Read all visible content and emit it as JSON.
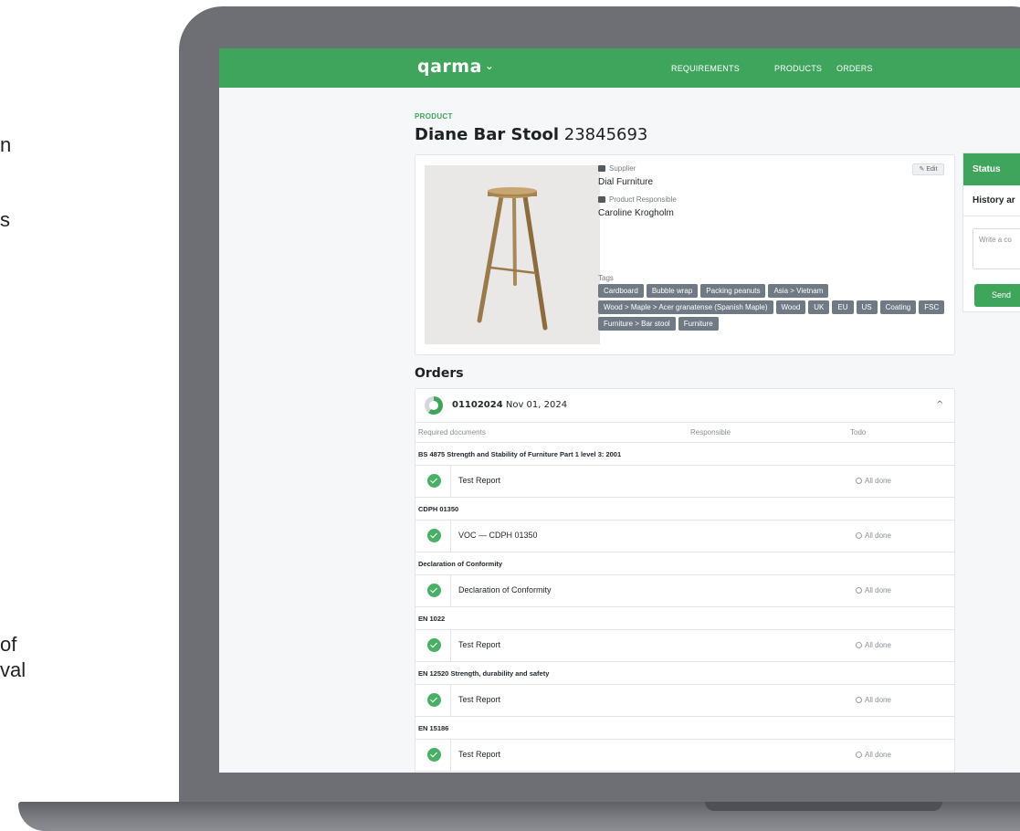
{
  "side_text": [
    "n",
    "s",
    "of",
    "val"
  ],
  "nav": {
    "logo": "qarma",
    "logo_caret": "⌄",
    "links": [
      "REQUIREMENTS",
      "PRODUCTS",
      "ORDERS"
    ]
  },
  "product": {
    "eyebrow": "PRODUCT",
    "name": "Diane Bar Stool",
    "number": "23845693",
    "supplier_label": "Supplier",
    "supplier": "Dial Furniture",
    "responsible_label": "Product Responsible",
    "responsible": "Caroline Krogholm",
    "edit_label": "Edit",
    "tags_label": "Tags",
    "tags": [
      "Cardboard",
      "Bubble wrap",
      "Packing peanuts",
      "Asia > Vietnam",
      "Wood > Maple > Acer granatense (Spanish Maple)",
      "Wood",
      "UK",
      "EU",
      "US",
      "Coating",
      "FSC",
      "Furniture > Bar stool",
      "Furniture"
    ]
  },
  "status_panel": {
    "title": "Status",
    "history": "History ar",
    "comment_placeholder": "Write a co",
    "send_label": "Send"
  },
  "orders": {
    "title": "Orders",
    "order_id": "01102024",
    "order_date": "Nov 01, 2024",
    "progress": 0.6,
    "columns": [
      "Required documents",
      "Responsible",
      "Todo"
    ],
    "groups": [
      {
        "name": "BS 4875 Strength and Stability of Furniture Part 1 level 3: 2001",
        "doc": "Test Report",
        "todo": "All done"
      },
      {
        "name": "CDPH 01350",
        "doc": "VOC — CDPH 01350",
        "todo": "All done"
      },
      {
        "name": "Declaration of Conformity",
        "doc": "Declaration of Conformity",
        "todo": "All done"
      },
      {
        "name": "EN 1022",
        "doc": "Test Report",
        "todo": "All done"
      },
      {
        "name": "EN 12520 Strength, durability and safety",
        "doc": "Test Report",
        "todo": "All done"
      },
      {
        "name": "EN 15186",
        "doc": "Test Report",
        "todo": "All done"
      }
    ]
  },
  "colors": {
    "brand_green": "#3fa55c",
    "tag_gray": "#707a84",
    "laptop_gray": "#6d6f74"
  }
}
